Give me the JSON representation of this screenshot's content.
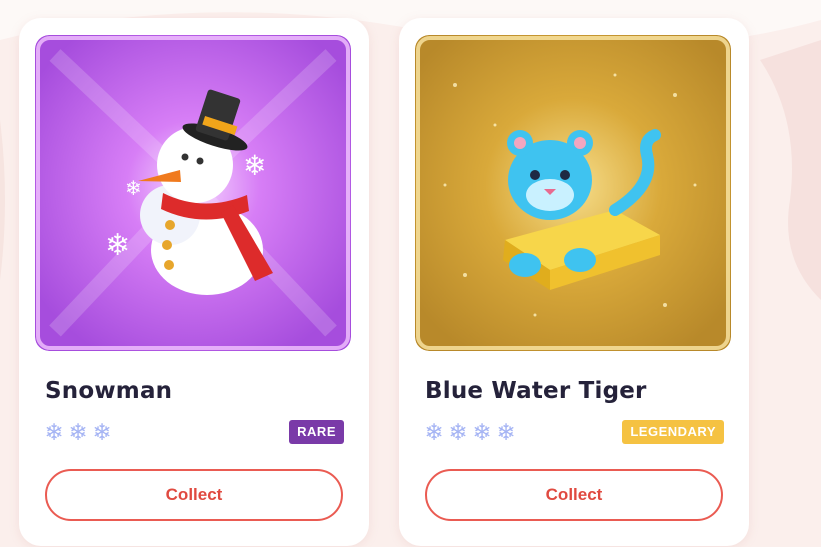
{
  "cards": [
    {
      "name": "Snowman",
      "rarity_level": 3,
      "rarity_label": "RARE",
      "collect_label": "Collect",
      "colors": {
        "badge": "#7a3aa8",
        "art_bg": "#c46bf0"
      }
    },
    {
      "name": "Blue Water Tiger",
      "rarity_level": 4,
      "rarity_label": "LEGENDARY",
      "collect_label": "Collect",
      "colors": {
        "badge": "#f5c242",
        "art_bg": "#d9a93a"
      }
    }
  ],
  "icons": {
    "rarity": "snowflake-icon"
  },
  "theme": {
    "page_bg": "#fbefec",
    "accent": "#ea5b52",
    "flake": "#a5b4f4"
  }
}
